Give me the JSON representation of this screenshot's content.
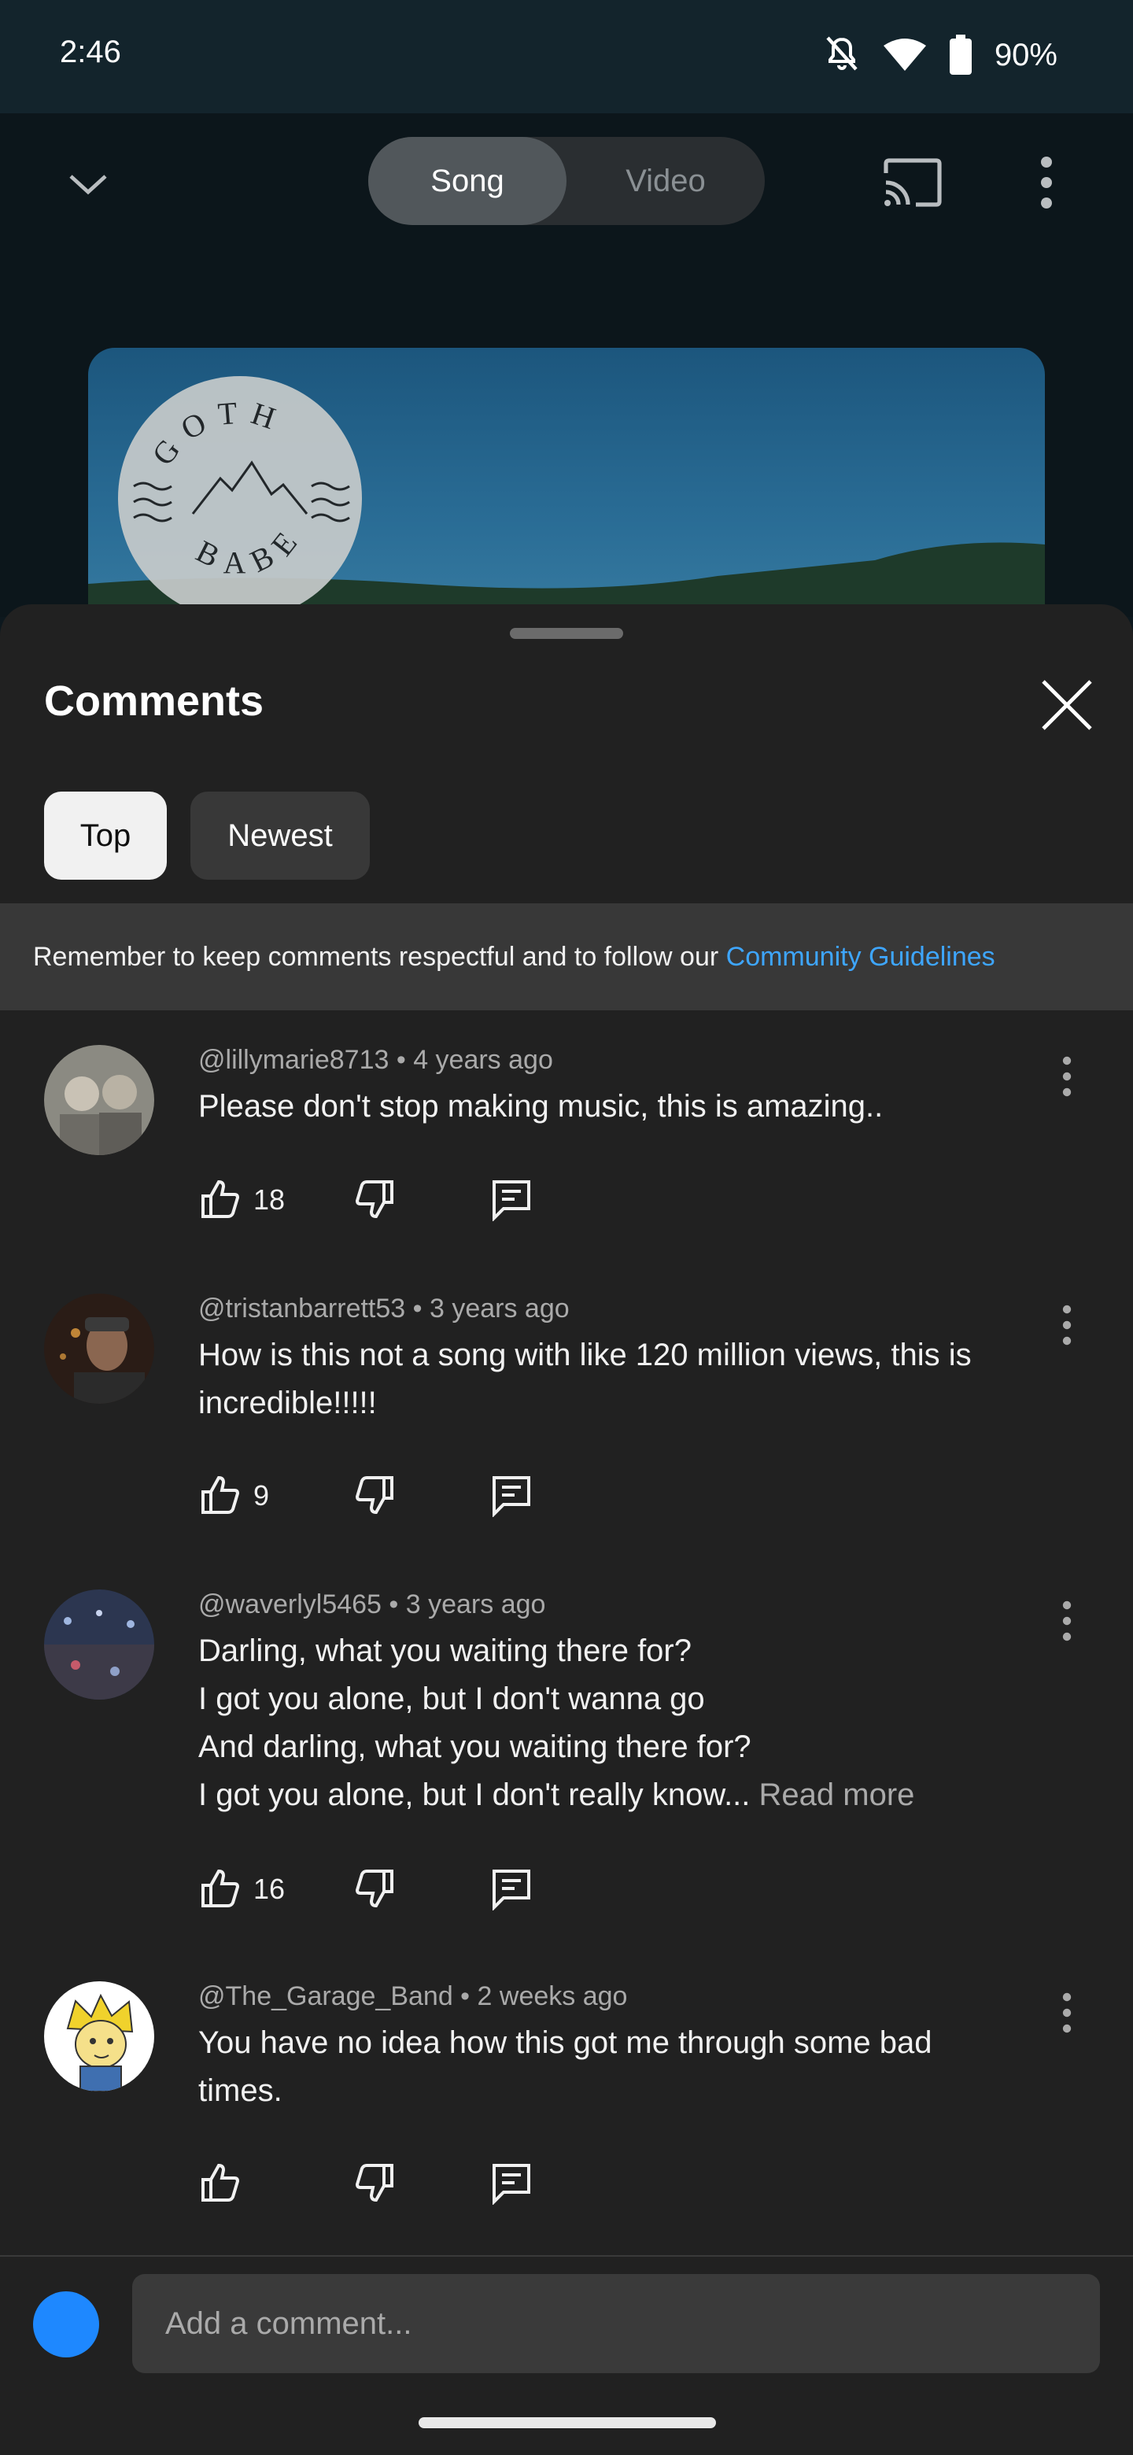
{
  "status_bar": {
    "time": "2:46",
    "battery": "90%"
  },
  "player": {
    "toggle": {
      "song_label": "Song",
      "video_label": "Video",
      "selected": "Song"
    },
    "artwork": {
      "logo_top": "GOTH",
      "logo_bottom": "BABE"
    }
  },
  "comments_panel": {
    "title": "Comments",
    "filters": {
      "top_label": "Top",
      "newest_label": "Newest",
      "selected": "Top"
    },
    "guidelines": {
      "text": "Remember to keep comments respectful and to follow our ",
      "link": "Community Guidelines"
    },
    "comments": [
      {
        "author": "@lillymarie8713",
        "age": "4 years ago",
        "lines": [
          "Please don't stop making music, this is amazing.."
        ],
        "read_more": "",
        "likes": "18"
      },
      {
        "author": "@tristanbarrett53",
        "age": "3 years ago",
        "lines": [
          "How is this not a song with like 120 million views, this is",
          "incredible!!!!!"
        ],
        "read_more": "",
        "likes": "9"
      },
      {
        "author": "@waverlyl5465",
        "age": "3 years ago",
        "lines": [
          "Darling, what you waiting there for?",
          "I got you alone, but I don't wanna go",
          "And darling, what you waiting there for?",
          "I got you alone, but I don't really know... "
        ],
        "read_more": "Read more",
        "likes": "16"
      },
      {
        "author": "@The_Garage_Band",
        "age": "2 weeks ago",
        "lines": [
          "You have no idea how this got me through some bad",
          "times."
        ],
        "read_more": "",
        "likes": ""
      }
    ],
    "input": {
      "placeholder": "Add a comment..."
    }
  },
  "colors": {
    "link": "#3ea6ff",
    "sheet_background": "#212121",
    "user_avatar": "#1e88ff"
  }
}
